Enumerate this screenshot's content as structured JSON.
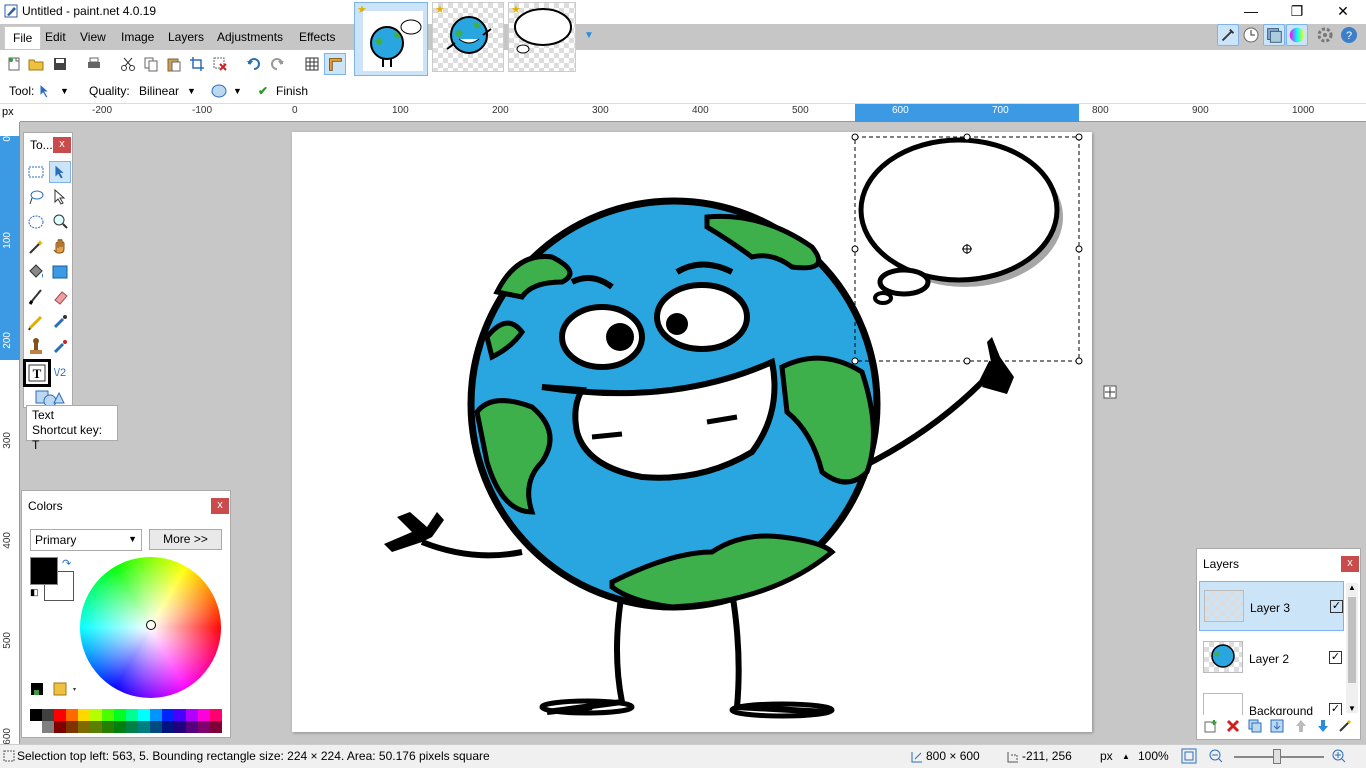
{
  "window": {
    "title": "Untitled - paint.net 4.0.19"
  },
  "menu": [
    "File",
    "Edit",
    "View",
    "Image",
    "Layers",
    "Adjustments",
    "Effects"
  ],
  "options": {
    "tool_label": "Tool:",
    "quality_label": "Quality:",
    "quality_value": "Bilinear",
    "finish_label": "Finish"
  },
  "ruler": {
    "unit": "px",
    "top_ticks": [
      "-200",
      "-100",
      "0",
      "100",
      "200",
      "300",
      "400",
      "500",
      "600",
      "700",
      "800",
      "900",
      "1000"
    ],
    "left_ticks": [
      "0",
      "100",
      "200",
      "300",
      "400",
      "500",
      "600"
    ]
  },
  "tools_panel": {
    "title": "To...",
    "close": "x"
  },
  "tooltip": {
    "name": "Text",
    "shortcut": "Shortcut key: T"
  },
  "colors_panel": {
    "title": "Colors",
    "close": "x",
    "mode": "Primary",
    "more_button": "More >>",
    "primary_color": "#000000",
    "secondary_color": "#ffffff"
  },
  "layers_panel": {
    "title": "Layers",
    "close": "x",
    "layers": [
      {
        "name": "Layer 3",
        "visible": "✓"
      },
      {
        "name": "Layer 2",
        "visible": "✓"
      },
      {
        "name": "Background",
        "visible": "✓"
      }
    ]
  },
  "status": {
    "selection": "Selection top left: 563, 5. Bounding rectangle size: 224 × 224. Area: 50.176 pixels square",
    "image_size": "800 × 600",
    "cursor": "-211, 256",
    "unit": "px",
    "zoom": "100%"
  },
  "colors": {
    "accent": "#3c9ae5",
    "earth_blue": "#29a6e0",
    "earth_green": "#3db04b"
  }
}
